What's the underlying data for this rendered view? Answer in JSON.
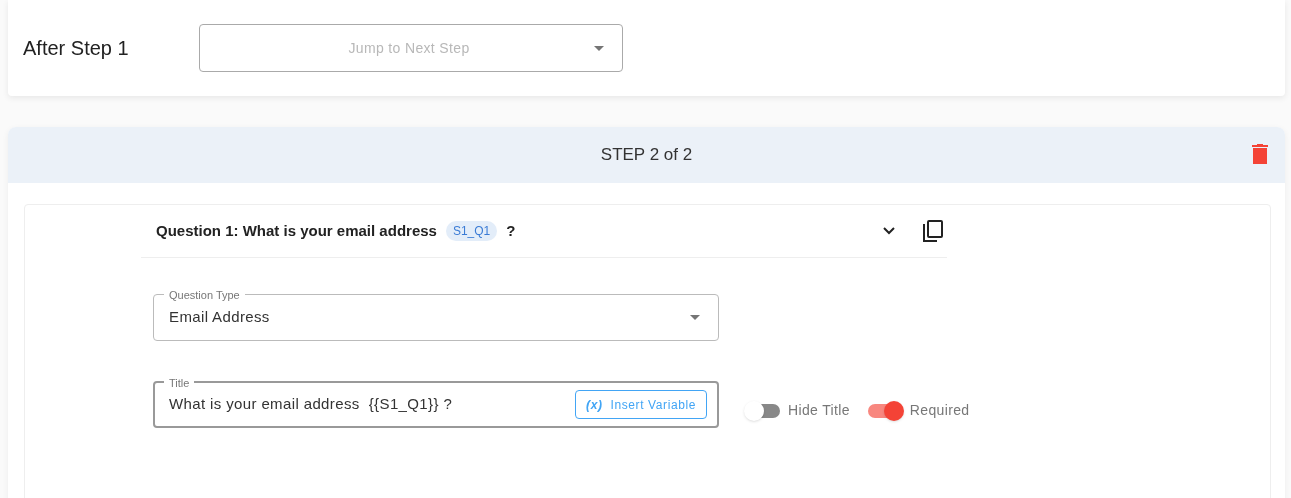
{
  "after_step": {
    "label": "After Step 1",
    "jump_select": {
      "placeholder": "Jump to Next Step"
    }
  },
  "step": {
    "title": "STEP 2 of 2",
    "question": {
      "heading": "Question 1: What is your email address",
      "variable_tag": "S1_Q1",
      "heading_suffix": "?",
      "expanded": true,
      "question_type": {
        "label": "Question Type",
        "value": "Email Address"
      },
      "title_field": {
        "label": "Title",
        "value": "What is your email address  {{S1_Q1}} ?",
        "insert_button": {
          "icon_text": "(x)",
          "label": "Insert Variable"
        }
      },
      "toggles": [
        {
          "label": "Hide Title",
          "on": false
        },
        {
          "label": "Required",
          "on": true
        }
      ]
    }
  }
}
